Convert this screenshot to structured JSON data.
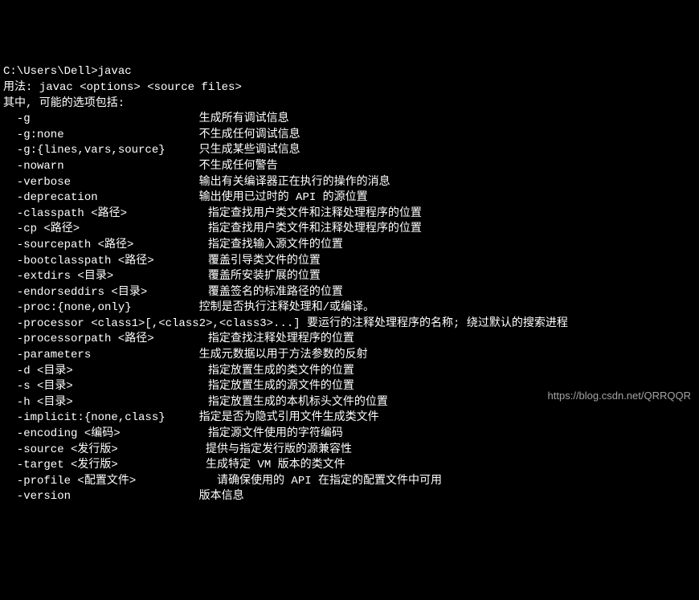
{
  "prompt": "C:\\Users\\Dell>javac",
  "usage": "用法: javac <options> <source files>",
  "intro": "其中, 可能的选项包括:",
  "options": [
    {
      "flag": "  -g",
      "desc": "生成所有调试信息"
    },
    {
      "flag": "  -g:none",
      "desc": "不生成任何调试信息"
    },
    {
      "flag": "  -g:{lines,vars,source}",
      "desc": "只生成某些调试信息"
    },
    {
      "flag": "  -nowarn",
      "desc": "不生成任何警告"
    },
    {
      "flag": "  -verbose",
      "desc": "输出有关编译器正在执行的操作的消息"
    },
    {
      "flag": "  -deprecation",
      "desc": "输出使用已过时的 API 的源位置"
    },
    {
      "flag": "  -classpath <路径>",
      "desc": "  指定查找用户类文件和注释处理程序的位置"
    },
    {
      "flag": "  -cp <路径>",
      "desc": "  指定查找用户类文件和注释处理程序的位置"
    },
    {
      "flag": "  -sourcepath <路径>",
      "desc": "  指定查找输入源文件的位置"
    },
    {
      "flag": "  -bootclasspath <路径>",
      "desc": "  覆盖引导类文件的位置"
    },
    {
      "flag": "  -extdirs <目录>",
      "desc": "  覆盖所安装扩展的位置"
    },
    {
      "flag": "  -endorseddirs <目录>",
      "desc": "  覆盖签名的标准路径的位置"
    },
    {
      "flag": "  -proc:{none,only}",
      "desc": "控制是否执行注释处理和/或编译。"
    },
    {
      "flag": "  -processor <class1>[,<class2>,<class3>...] 要运行的注释处理程序的名称; 绕过默认的搜索进程",
      "desc": ""
    },
    {
      "flag": "  -processorpath <路径>",
      "desc": "  指定查找注释处理程序的位置"
    },
    {
      "flag": "  -parameters",
      "desc": "生成元数据以用于方法参数的反射"
    },
    {
      "flag": "  -d <目录>",
      "desc": "  指定放置生成的类文件的位置"
    },
    {
      "flag": "  -s <目录>",
      "desc": "  指定放置生成的源文件的位置"
    },
    {
      "flag": "  -h <目录>",
      "desc": "  指定放置生成的本机标头文件的位置"
    },
    {
      "flag": "  -implicit:{none,class}",
      "desc": "指定是否为隐式引用文件生成类文件"
    },
    {
      "flag": "  -encoding <编码>",
      "desc": "  指定源文件使用的字符编码"
    },
    {
      "flag": "  -source <发行版>",
      "desc": "  提供与指定发行版的源兼容性"
    },
    {
      "flag": "  -target <发行版>",
      "desc": "  生成特定 VM 版本的类文件"
    },
    {
      "flag": "  -profile <配置文件>",
      "desc": "    请确保使用的 API 在指定的配置文件中可用"
    },
    {
      "flag": "  -version",
      "desc": "版本信息"
    }
  ],
  "watermark": "https://blog.csdn.net/QRRQQR"
}
